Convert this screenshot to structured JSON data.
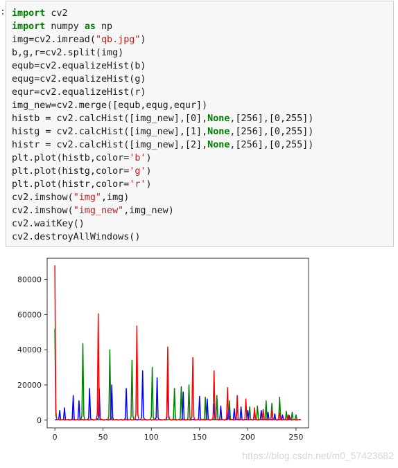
{
  "cell": {
    "prompt": ":",
    "lines": [
      [
        {
          "t": "import",
          "c": "kw"
        },
        {
          "t": " cv2"
        }
      ],
      [
        {
          "t": "import",
          "c": "kw"
        },
        {
          "t": " numpy "
        },
        {
          "t": "as",
          "c": "kw"
        },
        {
          "t": " np"
        }
      ],
      [
        {
          "t": "img=cv2.imread("
        },
        {
          "t": "\"qb.jpg\"",
          "c": "str"
        },
        {
          "t": ")"
        }
      ],
      [
        {
          "t": "b,g,r=cv2.split(img)"
        }
      ],
      [
        {
          "t": "equb=cv2.equalizeHist(b)"
        }
      ],
      [
        {
          "t": "equg=cv2.equalizeHist(g)"
        }
      ],
      [
        {
          "t": "equr=cv2.equalizeHist(r)"
        }
      ],
      [
        {
          "t": "img_new=cv2.merge([equb,equg,equr])"
        }
      ],
      [
        {
          "t": "histb = cv2.calcHist([img_new],[0],"
        },
        {
          "t": "None",
          "c": "kw"
        },
        {
          "t": ",[256],[0,255])"
        }
      ],
      [
        {
          "t": "histg = cv2.calcHist([img_new],[1],"
        },
        {
          "t": "None",
          "c": "kw"
        },
        {
          "t": ",[256],[0,255])"
        }
      ],
      [
        {
          "t": "histr = cv2.calcHist([img_new],[2],"
        },
        {
          "t": "None",
          "c": "kw"
        },
        {
          "t": ",[256],[0,255])"
        }
      ],
      [
        {
          "t": "plt.plot(histb,color="
        },
        {
          "t": "'b'",
          "c": "str"
        },
        {
          "t": ")"
        }
      ],
      [
        {
          "t": "plt.plot(histg,color="
        },
        {
          "t": "'g'",
          "c": "str"
        },
        {
          "t": ")"
        }
      ],
      [
        {
          "t": "plt.plot(histr,color="
        },
        {
          "t": "'r'",
          "c": "str"
        },
        {
          "t": ")"
        }
      ],
      [
        {
          "t": "cv2.imshow("
        },
        {
          "t": "\"img\"",
          "c": "str"
        },
        {
          "t": ",img)"
        }
      ],
      [
        {
          "t": "cv2.imshow("
        },
        {
          "t": "\"img_new\"",
          "c": "str"
        },
        {
          "t": ",img_new)"
        }
      ],
      [
        {
          "t": "cv2.waitKey()"
        }
      ],
      [
        {
          "t": "cv2.destroyAllWindows()"
        }
      ]
    ]
  },
  "chart_data": {
    "type": "line",
    "xlim": [
      -8,
      263
    ],
    "ylim": [
      -4400,
      92000
    ],
    "xticks": [
      0,
      50,
      100,
      150,
      200,
      250
    ],
    "yticks": [
      0,
      20000,
      40000,
      60000,
      80000
    ],
    "colors": {
      "b": "#0000ff",
      "g": "#008000",
      "r": "#ff0000"
    },
    "series": [
      {
        "key": "g",
        "peaks": [
          [
            0,
            52000
          ],
          [
            29,
            43500
          ],
          [
            57,
            40000
          ],
          [
            80,
            34000
          ],
          [
            101,
            30000
          ],
          [
            124,
            18000
          ],
          [
            131,
            19000
          ],
          [
            139,
            20000
          ],
          [
            156,
            13000
          ],
          [
            168,
            14000
          ],
          [
            181,
            11000
          ],
          [
            189,
            11000
          ],
          [
            202,
            7500
          ],
          [
            210,
            8000
          ],
          [
            219,
            11000
          ],
          [
            225,
            9500
          ],
          [
            233,
            13000
          ],
          [
            240,
            5000
          ],
          [
            246,
            4500
          ],
          [
            250,
            3000
          ]
        ]
      },
      {
        "key": "b",
        "peaks": [
          [
            5,
            5500
          ],
          [
            10,
            7000
          ],
          [
            19,
            14000
          ],
          [
            25,
            11000
          ],
          [
            36,
            18000
          ],
          [
            46,
            18000
          ],
          [
            59,
            20000
          ],
          [
            74,
            18000
          ],
          [
            91,
            28000
          ],
          [
            106,
            24000
          ],
          [
            117,
            22000
          ],
          [
            133,
            16000
          ],
          [
            150,
            13500
          ],
          [
            158,
            12000
          ],
          [
            165,
            9000
          ],
          [
            172,
            8000
          ],
          [
            180,
            7000
          ],
          [
            186,
            6500
          ],
          [
            193,
            7500
          ],
          [
            200,
            5500
          ],
          [
            207,
            5000
          ],
          [
            214,
            5500
          ],
          [
            221,
            4500
          ],
          [
            228,
            3500
          ],
          [
            236,
            3000
          ],
          [
            243,
            2500
          ]
        ]
      },
      {
        "key": "r",
        "peaks": [
          [
            0,
            88000
          ],
          [
            45,
            60500
          ],
          [
            85,
            53500
          ],
          [
            117,
            41500
          ],
          [
            143,
            35500
          ],
          [
            165,
            28000
          ],
          [
            179,
            18500
          ],
          [
            189,
            14000
          ],
          [
            198,
            12000
          ],
          [
            207,
            7000
          ],
          [
            216,
            6000
          ],
          [
            225,
            5500
          ],
          [
            233,
            4000
          ],
          [
            242,
            3000
          ]
        ]
      }
    ]
  },
  "watermark": "https://blog.csdn.net/m0_57423682"
}
